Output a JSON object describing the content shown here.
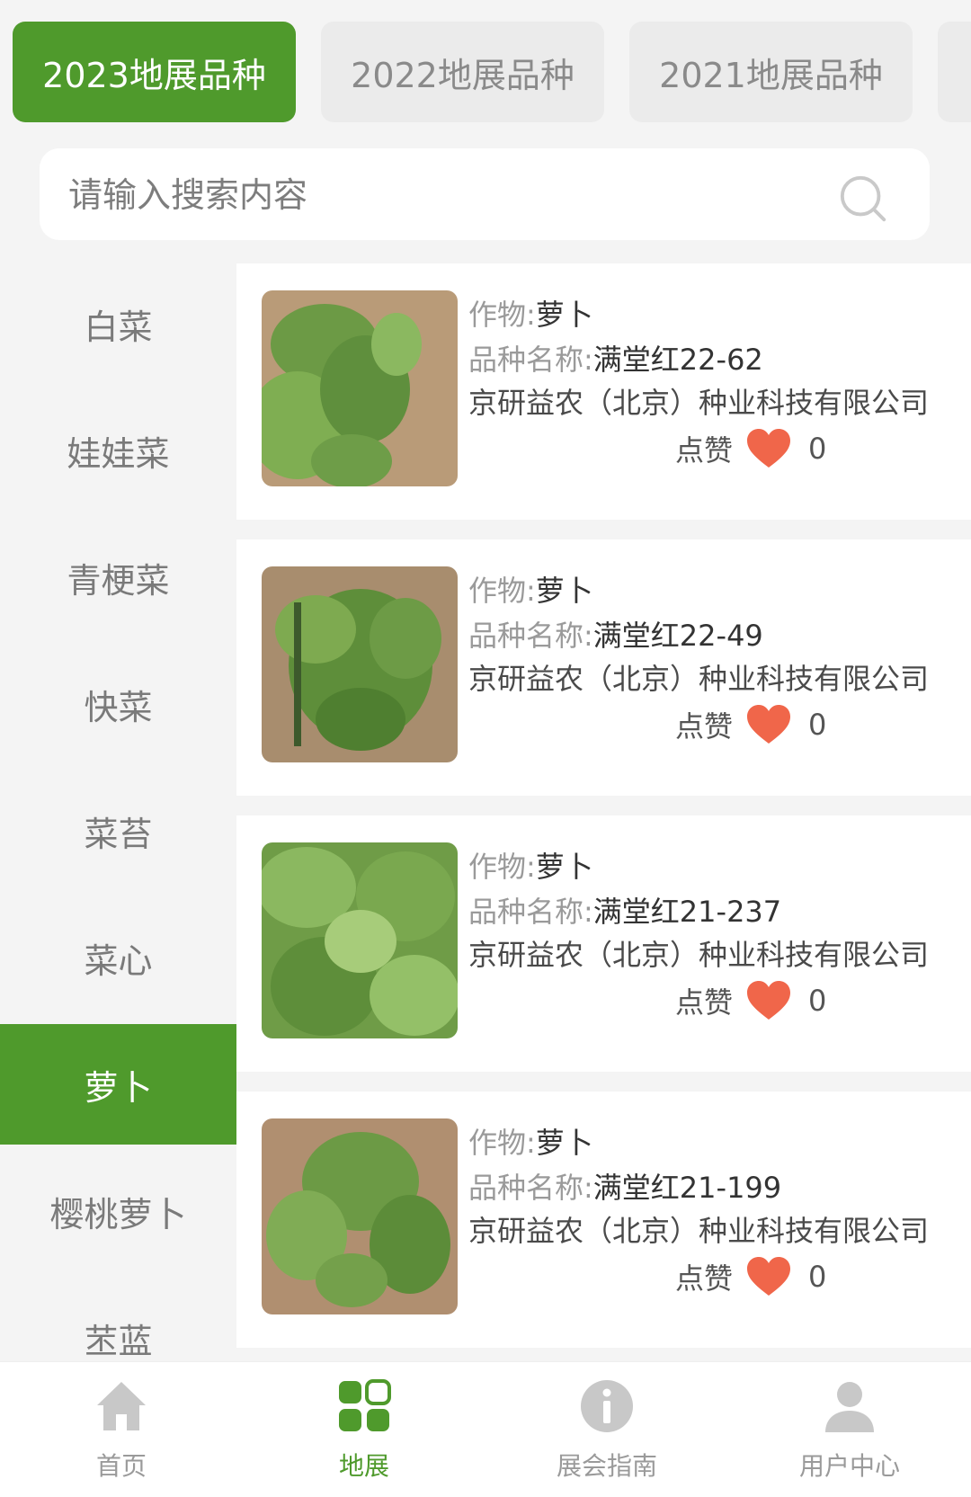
{
  "tabs": [
    {
      "label": "2023地展品种",
      "active": true
    },
    {
      "label": "2022地展品种",
      "active": false
    },
    {
      "label": "2021地展品种",
      "active": false
    }
  ],
  "search": {
    "placeholder": "请输入搜索内容",
    "icon": "search-icon"
  },
  "sidebar": {
    "items": [
      {
        "label": "白菜"
      },
      {
        "label": "娃娃菜"
      },
      {
        "label": "青梗菜"
      },
      {
        "label": "快菜"
      },
      {
        "label": "菜苔"
      },
      {
        "label": "菜心"
      },
      {
        "label": "萝卜",
        "active": true
      },
      {
        "label": "樱桃萝卜"
      },
      {
        "label": "苤蓝"
      }
    ]
  },
  "list": {
    "crop_label": "作物:",
    "variety_label": "品种名称:",
    "like_label": "点赞",
    "items": [
      {
        "crop": "萝卜",
        "variety": "满堂红22-62",
        "company": "京研益农（北京）种业科技有限公司",
        "likes": "0"
      },
      {
        "crop": "萝卜",
        "variety": "满堂红22-49",
        "company": "京研益农（北京）种业科技有限公司",
        "likes": "0"
      },
      {
        "crop": "萝卜",
        "variety": "满堂红21-237",
        "company": "京研益农（北京）种业科技有限公司",
        "likes": "0"
      },
      {
        "crop": "萝卜",
        "variety": "满堂红21-199",
        "company": "京研益农（北京）种业科技有限公司",
        "likes": "0"
      }
    ]
  },
  "bottom_nav": {
    "items": [
      {
        "label": "首页",
        "icon": "home-icon"
      },
      {
        "label": "地展",
        "icon": "grid-icon",
        "active": true
      },
      {
        "label": "展会指南",
        "icon": "info-icon"
      },
      {
        "label": "用户中心",
        "icon": "user-icon"
      }
    ]
  },
  "colors": {
    "accent": "#4f9a2c",
    "heart": "#f0664a",
    "background": "#f4f4f4"
  }
}
